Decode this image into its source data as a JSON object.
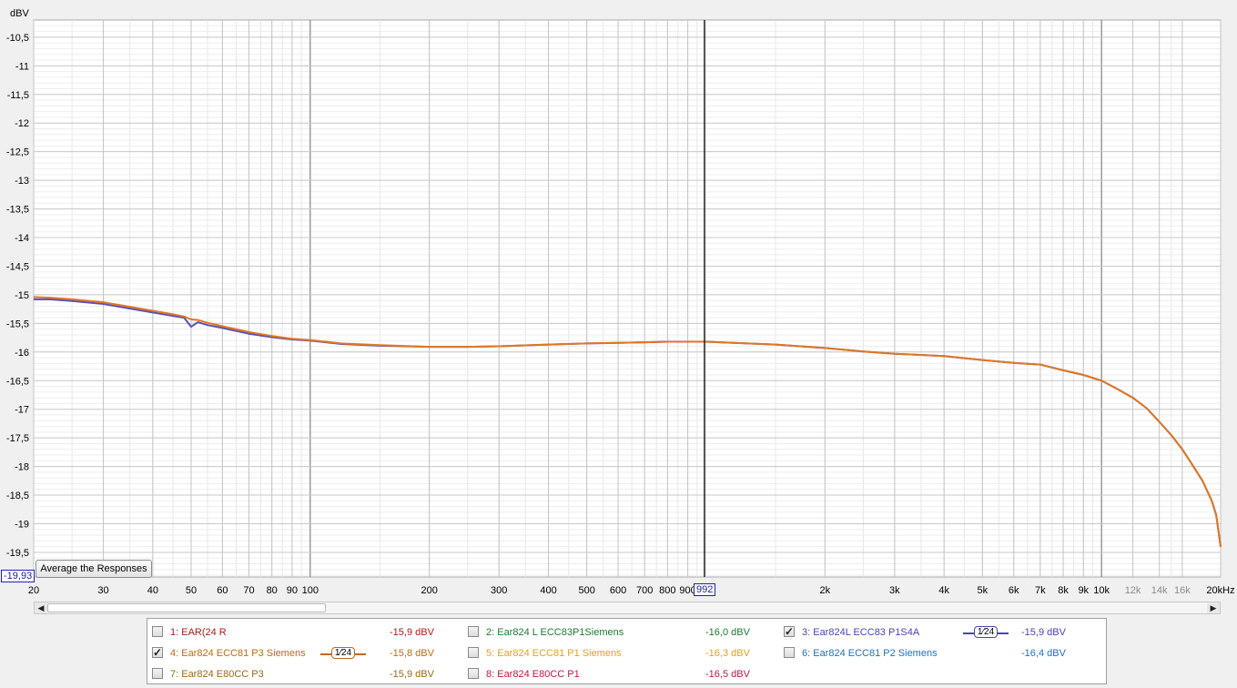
{
  "chart_data": {
    "type": "line",
    "title": "",
    "xlabel": "",
    "ylabel": "dBV",
    "x_scale": "log",
    "xlim": [
      20,
      20000
    ],
    "ylim": [
      -19.93,
      -10.2
    ],
    "grid": true,
    "x_ticks": [
      {
        "v": 20,
        "label": "20"
      },
      {
        "v": 30,
        "label": "30"
      },
      {
        "v": 40,
        "label": "40"
      },
      {
        "v": 50,
        "label": "50"
      },
      {
        "v": 60,
        "label": "60"
      },
      {
        "v": 70,
        "label": "70"
      },
      {
        "v": 80,
        "label": "80"
      },
      {
        "v": 90,
        "label": "90"
      },
      {
        "v": 100,
        "label": "100"
      },
      {
        "v": 200,
        "label": "200"
      },
      {
        "v": 300,
        "label": "300"
      },
      {
        "v": 400,
        "label": "400"
      },
      {
        "v": 500,
        "label": "500"
      },
      {
        "v": 600,
        "label": "600"
      },
      {
        "v": 700,
        "label": "700"
      },
      {
        "v": 800,
        "label": "800"
      },
      {
        "v": 900,
        "label": "900"
      },
      {
        "v": 2000,
        "label": "2k"
      },
      {
        "v": 3000,
        "label": "3k"
      },
      {
        "v": 4000,
        "label": "4k"
      },
      {
        "v": 5000,
        "label": "5k"
      },
      {
        "v": 6000,
        "label": "6k"
      },
      {
        "v": 7000,
        "label": "7k"
      },
      {
        "v": 8000,
        "label": "8k"
      },
      {
        "v": 9000,
        "label": "9k"
      },
      {
        "v": 10000,
        "label": "10k"
      },
      {
        "v": 12000,
        "label": "12k",
        "muted": true
      },
      {
        "v": 14000,
        "label": "14k",
        "muted": true
      },
      {
        "v": 16000,
        "label": "16k",
        "muted": true
      },
      {
        "v": 20000,
        "label": "20kHz"
      }
    ],
    "y_ticks": [
      {
        "v": -10.5,
        "label": "-10,5"
      },
      {
        "v": -11,
        "label": "-11"
      },
      {
        "v": -11.5,
        "label": "-11,5"
      },
      {
        "v": -12,
        "label": "-12"
      },
      {
        "v": -12.5,
        "label": "-12,5"
      },
      {
        "v": -13,
        "label": "-13"
      },
      {
        "v": -13.5,
        "label": "-13,5"
      },
      {
        "v": -14,
        "label": "-14"
      },
      {
        "v": -14.5,
        "label": "-14,5"
      },
      {
        "v": -15,
        "label": "-15"
      },
      {
        "v": -15.5,
        "label": "-15,5"
      },
      {
        "v": -16,
        "label": "-16"
      },
      {
        "v": -16.5,
        "label": "-16,5"
      },
      {
        "v": -17,
        "label": "-17"
      },
      {
        "v": -17.5,
        "label": "-17,5"
      },
      {
        "v": -18,
        "label": "-18"
      },
      {
        "v": -18.5,
        "label": "-18,5"
      },
      {
        "v": -19,
        "label": "-19"
      },
      {
        "v": -19.5,
        "label": "-19,5"
      }
    ],
    "cursor": {
      "x": 992,
      "x_label": "992",
      "y_label": "-19,93"
    },
    "series": [
      {
        "name": "3: Ear824L ECC83 P1S4A",
        "color": "#5a4fbf",
        "x": [
          20,
          22,
          25,
          30,
          35,
          40,
          45,
          48,
          50,
          52,
          55,
          60,
          70,
          80,
          90,
          100,
          120,
          150,
          200,
          250,
          300,
          400,
          500,
          600,
          700,
          800,
          900,
          1000,
          1500,
          2000,
          2500,
          3000,
          4000,
          5000,
          6000,
          7000,
          8000,
          9000,
          10000,
          11000,
          12000,
          13000,
          14000,
          15000,
          16000,
          17000,
          18000,
          19000,
          19500,
          20000
        ],
        "y": [
          -15.08,
          -15.08,
          -15.11,
          -15.16,
          -15.24,
          -15.31,
          -15.37,
          -15.4,
          -15.56,
          -15.48,
          -15.53,
          -15.58,
          -15.68,
          -15.74,
          -15.78,
          -15.8,
          -15.86,
          -15.89,
          -15.91,
          -15.91,
          -15.9,
          -15.87,
          -15.85,
          -15.84,
          -15.83,
          -15.82,
          -15.82,
          -15.82,
          -15.87,
          -15.93,
          -15.99,
          -16.03,
          -16.07,
          -16.14,
          -16.19,
          -16.22,
          -16.32,
          -16.4,
          -16.5,
          -16.65,
          -16.8,
          -16.98,
          -17.22,
          -17.45,
          -17.7,
          -17.98,
          -18.25,
          -18.6,
          -18.85,
          -19.4
        ]
      },
      {
        "name": "4: Ear824 ECC81 P3 Siemens",
        "color": "#e07820",
        "x": [
          20,
          22,
          25,
          30,
          35,
          40,
          45,
          48,
          50,
          52,
          55,
          60,
          70,
          80,
          90,
          100,
          120,
          150,
          200,
          250,
          300,
          400,
          500,
          600,
          700,
          800,
          900,
          1000,
          1500,
          2000,
          2500,
          3000,
          4000,
          5000,
          6000,
          7000,
          8000,
          9000,
          10000,
          11000,
          12000,
          13000,
          14000,
          15000,
          16000,
          17000,
          18000,
          19000,
          19500,
          20000
        ],
        "y": [
          -15.04,
          -15.05,
          -15.08,
          -15.13,
          -15.21,
          -15.28,
          -15.34,
          -15.38,
          -15.43,
          -15.44,
          -15.49,
          -15.55,
          -15.65,
          -15.72,
          -15.77,
          -15.79,
          -15.85,
          -15.88,
          -15.91,
          -15.91,
          -15.9,
          -15.87,
          -15.85,
          -15.84,
          -15.83,
          -15.82,
          -15.82,
          -15.82,
          -15.87,
          -15.93,
          -15.99,
          -16.03,
          -16.07,
          -16.14,
          -16.19,
          -16.22,
          -16.32,
          -16.4,
          -16.5,
          -16.65,
          -16.8,
          -16.98,
          -17.22,
          -17.45,
          -17.7,
          -17.98,
          -18.25,
          -18.6,
          -18.85,
          -19.4
        ]
      }
    ]
  },
  "ui": {
    "average_button_label": "Average the Responses",
    "scroll_left": "◀",
    "scroll_right": "▶",
    "scroll_position": 0.24
  },
  "legend": [
    {
      "label": "1: EAR(24 R",
      "value": "-15,9 dBV",
      "checked": false,
      "color": "#b01818",
      "smoothing": ""
    },
    {
      "label": "2: Ear824 L ECC83P1Siemens",
      "value": "-16,0 dBV",
      "checked": false,
      "color": "#1c7a30",
      "smoothing": ""
    },
    {
      "label": "3: Ear824L ECC83 P1S4A",
      "value": "-15,9 dBV",
      "checked": true,
      "color": "#4a44b8",
      "smoothing": "1⁄24"
    },
    {
      "label": "4: Ear824 ECC81 P3 Siemens",
      "value": "-15,8 dBV",
      "checked": true,
      "color": "#c06a10",
      "smoothing": "1⁄24"
    },
    {
      "label": "5: Ear824 ECC81 P1 Siemens",
      "value": "-16,3 dBV",
      "checked": false,
      "color": "#e6a020",
      "smoothing": ""
    },
    {
      "label": "6: Ear824 ECC81 P2 Siemens",
      "value": "-16,4 dBV",
      "checked": false,
      "color": "#2070c0",
      "smoothing": ""
    },
    {
      "label": "7: Ear824 E80CC P3",
      "value": "-15,9 dBV",
      "checked": false,
      "color": "#9a6a10",
      "smoothing": ""
    },
    {
      "label": "8: Ear824 E80CC P1",
      "value": "-16,5 dBV",
      "checked": false,
      "color": "#c01840",
      "smoothing": ""
    }
  ]
}
